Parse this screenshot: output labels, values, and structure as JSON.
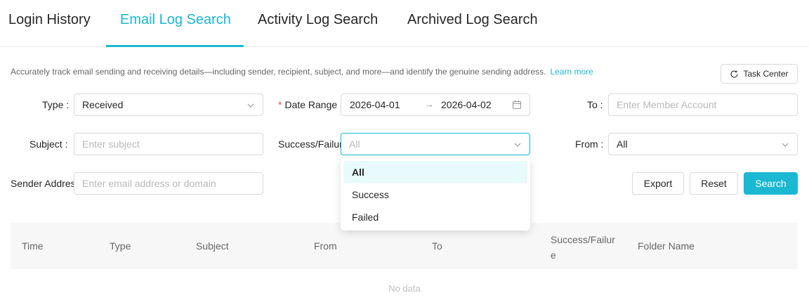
{
  "tabs": [
    {
      "label": "Login History"
    },
    {
      "label": "Email Log Search"
    },
    {
      "label": "Activity Log Search"
    },
    {
      "label": "Archived Log Search"
    }
  ],
  "active_tab": "Email Log Search",
  "description": {
    "text": "Accurately track email sending and receiving details—including sender, recipient, subject, and more—and identify the genuine sending address.",
    "link": "Learn more"
  },
  "task_center_label": "Task Center",
  "form": {
    "type": {
      "label": "Type",
      "value": "Received"
    },
    "date_range": {
      "label": "Date Range",
      "start": "2026-04-01",
      "arrow": "→",
      "end": "2026-04-02"
    },
    "to": {
      "label": "To",
      "placeholder": "Enter Member Account"
    },
    "subject": {
      "label": "Subject",
      "placeholder": "Enter subject"
    },
    "success_failure": {
      "label": "Success/Failure",
      "placeholder": "All"
    },
    "from": {
      "label": "From",
      "value": "All"
    },
    "sender_address": {
      "label": "Sender Address",
      "placeholder": "Enter email address or domain"
    }
  },
  "buttons": {
    "export": "Export",
    "reset": "Reset",
    "search": "Search"
  },
  "dropdown": {
    "options": [
      "All",
      "Success",
      "Failed"
    ],
    "selected": "All"
  },
  "table": {
    "columns": [
      "Time",
      "Type",
      "Subject",
      "From",
      "To",
      "Success/Failure",
      "Folder Name"
    ],
    "empty_text": "No data"
  },
  "colors": {
    "accent": "#1bb8d2",
    "required": "#e5484d"
  }
}
